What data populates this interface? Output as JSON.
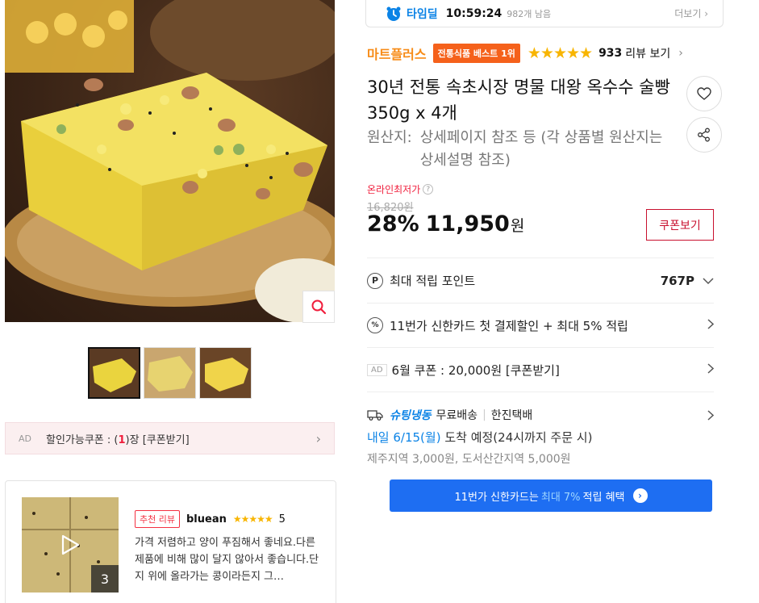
{
  "product": {
    "title": "30년 전통 속초시장 명물 대왕 옥수수 술빵 350g x 4개",
    "origin_label": "원산지:",
    "origin_value": "상세페이지 참조 등 (각 상품별 원산지는 상세설명 참조)"
  },
  "timedeal": {
    "label": "타임딜",
    "time": "10:59:24",
    "remaining": "982개 남음",
    "more": "더보기 ›"
  },
  "seller": {
    "name": "마트플러스",
    "badge": "전통식품 베스트 1위",
    "stars": "★★★★★",
    "review_count": "933",
    "review_link": "리뷰 보기"
  },
  "price": {
    "lowest_label": "온라인최저가",
    "original": "16,820원",
    "discount": "28%",
    "value": "11,950",
    "unit": "원",
    "coupon_button": "쿠폰보기"
  },
  "rows": {
    "points_label": "최대 적립 포인트",
    "points_value": "767P",
    "card_discount": "11번가 신한카드 첫 결제할인 + 최대 5% 적립",
    "ad_tag": "AD",
    "coupon_row": "6월 쿠폰 : 20,000원 [쿠폰받기]"
  },
  "delivery": {
    "brand": "슈팅냉동",
    "free": "무료배송",
    "sep": "|",
    "courier": "한진택배",
    "date": "내일 6/15(월)",
    "arrival": "도착 예정(24시까지 주문 시)",
    "extra_fee": "제주지역 3,000원, 도서산간지역 5,000원"
  },
  "card_banner": {
    "prefix": "11번가 신한카드는",
    "highlight": "최대 7%",
    "suffix": "적립 혜택",
    "arrow": "›"
  },
  "left": {
    "coupon_ad": "AD",
    "coupon_prefix": "할인가능쿠폰 : (",
    "coupon_num": "1",
    "coupon_suffix": ")장 [쿠폰받기]",
    "coupon_chev": "›"
  },
  "review": {
    "badge": "추천 리뷰",
    "user": "bluean",
    "stars": "★★★★★",
    "score": "5",
    "text": "가격 저렴하고 양이 푸짐해서 좋네요.다른 제품에 비해 많이 달지 않아서 좋습니다.단지 위에 올라가는 콩이라든지 그…",
    "photo_count": "3"
  },
  "icons": {
    "timer": "alarm-clock-icon",
    "heart": "heart-icon",
    "share": "share-icon",
    "zoom": "magnifier-icon",
    "points": "p-circle-icon",
    "percent": "percent-icon",
    "truck": "truck-icon",
    "play": "play-icon"
  },
  "colors": {
    "accent_blue": "#0b83e6",
    "seller_orange": "#f78c18",
    "badge_orange": "#f5611b",
    "price_red": "#f01e3c",
    "banner_blue": "#1e6ef2"
  }
}
